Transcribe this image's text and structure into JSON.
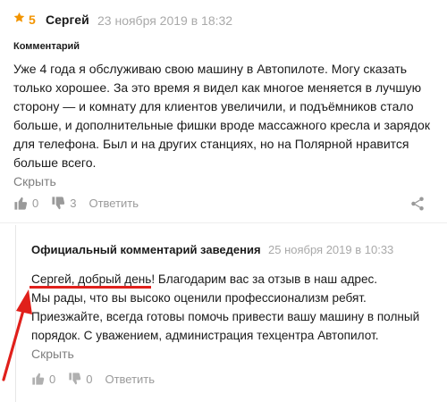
{
  "review": {
    "rating": "5",
    "author": "Сергей",
    "date": "23 ноября 2019 в 18:32",
    "section_label": "Комментарий",
    "lines": [
      "Уже 4 года я обслуживаю свою машину в Автопилоте. Могу сказать",
      "только хорошее. За это время я видел как многое меняется в лучшую",
      "сторону — и комнату для клиентов увеличили, и подъёмников стало",
      "больше, и дополнительные фишки вроде массажного кресла и зарядок",
      "для телефона. Был и на других станциях, но на Полярной нравится",
      "больше всего."
    ],
    "hide_label": "Скрыть",
    "likes": "0",
    "dislikes": "3",
    "reply_label": "Ответить"
  },
  "official_reply": {
    "title": "Официальный комментарий заведения",
    "date": "25 ноября 2019 в 10:33",
    "greeting": "Сергей, добрый день!",
    "first_line_rest": " Благодарим вас за отзыв в наш адрес.",
    "lines": [
      "Мы рады, что вы высоко оценили профессионализм ребят.",
      "Приезжайте, всегда готовы помочь привести вашу машину в полный",
      "порядок. С уважением, администрация техцентра Автопилот."
    ],
    "hide_label": "Скрыть",
    "likes": "0",
    "dislikes": "0",
    "reply_label": "Ответить"
  },
  "colors": {
    "star": "#f29400",
    "annotation": "#e0201b"
  },
  "icons": [
    "star-icon",
    "thumbs-up-icon",
    "thumbs-down-icon",
    "share-icon",
    "annotation-arrow"
  ]
}
